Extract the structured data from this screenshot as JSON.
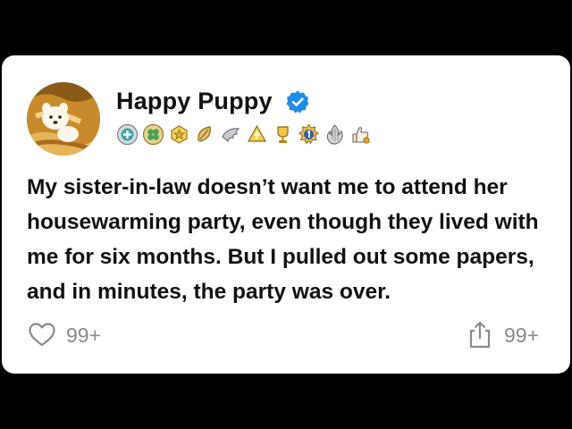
{
  "post": {
    "author": {
      "name": "Happy Puppy",
      "verified": true,
      "avatar_icon": "cartoon-dog-avatar",
      "badges": [
        {
          "icon": "teal-cross-badge-icon",
          "color": "#3aa6a6"
        },
        {
          "icon": "green-clover-badge-icon",
          "color": "#4aa05a"
        },
        {
          "icon": "gold-star-badge-icon",
          "color": "#e2b22a"
        },
        {
          "icon": "gold-leaf-badge-icon",
          "color": "#d6a431"
        },
        {
          "icon": "silver-wing-badge-icon",
          "color": "#9aa0a6"
        },
        {
          "icon": "gold-arrow-up-badge-icon",
          "color": "#e8c23a"
        },
        {
          "icon": "gold-trophy-badge-icon",
          "color": "#d9a92a"
        },
        {
          "icon": "number-one-badge-icon",
          "color": "#2e5fb8"
        },
        {
          "icon": "silver-flame-badge-icon",
          "color": "#b0b4b8"
        },
        {
          "icon": "thumbs-up-badge-icon",
          "color": "#e6a02d"
        }
      ]
    },
    "text": "My sister-in-law doesn’t want me to attend her housewarming party, even though they lived with me for six months. But I pulled out some papers, and in minutes, the party was over.",
    "likes_count": "99+",
    "shares_count": "99+"
  },
  "colors": {
    "background": "#000000",
    "card": "#ffffff",
    "text": "#111111",
    "muted": "#8a8a8a",
    "verified_blue": "#1d8cf0"
  }
}
